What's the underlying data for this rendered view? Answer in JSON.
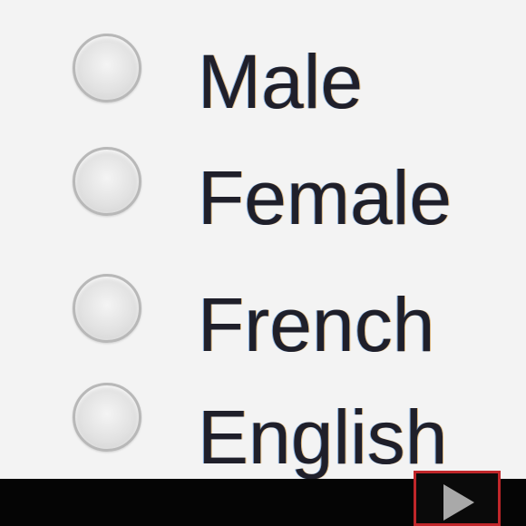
{
  "options": [
    {
      "label": "Male",
      "checked": false
    },
    {
      "label": "Female",
      "checked": false
    },
    {
      "label": "French",
      "checked": false
    },
    {
      "label": "English",
      "checked": false
    }
  ],
  "player": {
    "icon": "play-icon",
    "accent_color": "#c0262a"
  }
}
